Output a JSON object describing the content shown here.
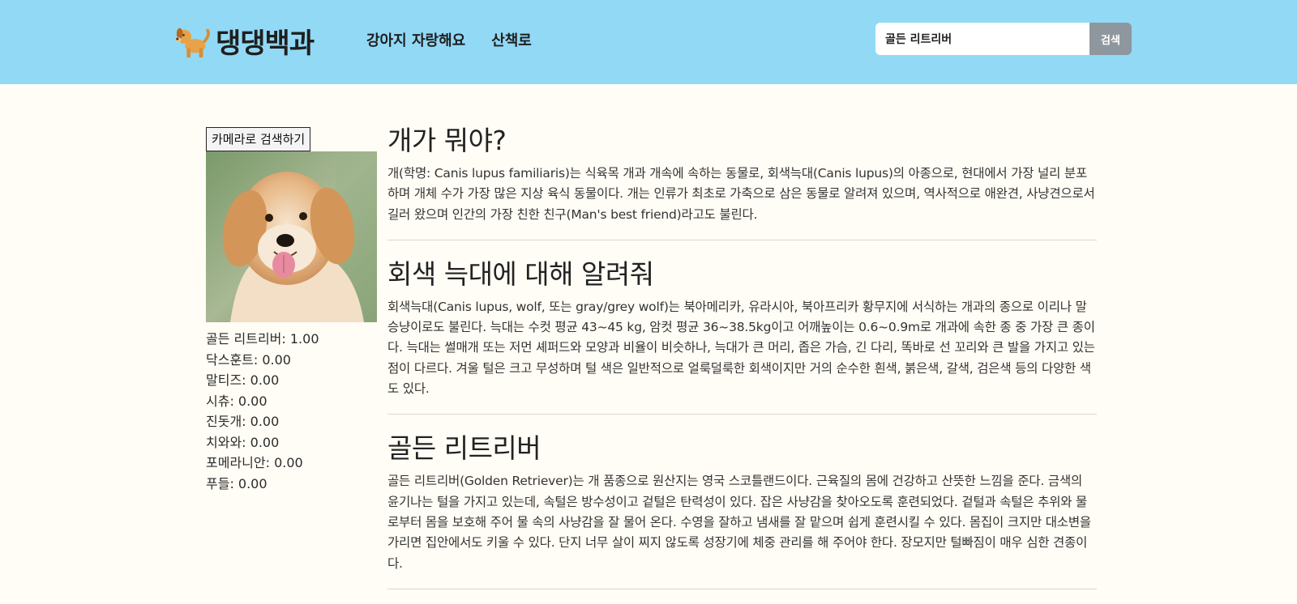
{
  "header": {
    "logo_text": "댕댕백과",
    "nav": [
      "강아지 자랑해요",
      "산책로"
    ],
    "search": {
      "value": "골든 리트리버",
      "button_label": "검색"
    }
  },
  "sidebar": {
    "camera_button_label": "카메라로 검색하기",
    "predictions": [
      {
        "label": "골든 리트리버: 1.00",
        "score": 1.0
      },
      {
        "label": "닥스훈트: 0.00",
        "score": 0.0
      },
      {
        "label": "말티즈: 0.00",
        "score": 0.0
      },
      {
        "label": "시츄: 0.00",
        "score": 0.0
      },
      {
        "label": "진돗개: 0.00",
        "score": 0.0
      },
      {
        "label": "치와와: 0.00",
        "score": 0.0
      },
      {
        "label": "포메라니안: 0.00",
        "score": 0.0
      },
      {
        "label": "푸들: 0.00",
        "score": 0.0
      }
    ]
  },
  "sections": [
    {
      "title": "개가 뭐야?",
      "body": "개(학명: Canis lupus familiaris)는 식육목 개과 개속에 속하는 동물로, 회색늑대(Canis lupus)의 아종으로, 현대에서 가장 널리 분포하며 개체 수가 가장 많은 지상 육식 동물이다. 개는 인류가 최초로 가축으로 삼은 동물로 알려져 있으며, 역사적으로 애완견, 사냥견으로서 길러 왔으며 인간의 가장 친한 친구(Man's best friend)라고도 불린다."
    },
    {
      "title": "회색 늑대에 대해 알려줘",
      "body": "회색늑대(Canis lupus, wolf, 또는 gray/grey wolf)는 북아메리카, 유라시아, 북아프리카 황무지에 서식하는 개과의 종으로 이리나 말승냥이로도 불린다. 늑대는 수컷 평균 43~45 kg, 암컷 평균 36~38.5kg이고 어깨높이는 0.6~0.9m로 개과에 속한 종 중 가장 큰 종이다. 늑대는 썰매개 또는 저먼 셰퍼드와 모양과 비율이 비슷하나, 늑대가 큰 머리, 좁은 가슴, 긴 다리, 똑바로 선 꼬리와 큰 발을 가지고 있는 점이 다르다. 겨울 털은 크고 무성하며 털 색은 일반적으로 얼룩덜룩한 회색이지만 거의 순수한 흰색, 붉은색, 갈색, 검은색 등의 다양한 색도 있다."
    },
    {
      "title": "골든 리트리버",
      "body": "골든 리트리버(Golden Retriever)는 개 품종으로 원산지는 영국 스코틀랜드이다. 근육질의 몸에 건강하고 산뜻한 느낌을 준다. 금색의 윤기나는 털을 가지고 있는데, 속털은 방수성이고 겉털은 탄력성이 있다. 잡은 사냥감을 찾아오도록 훈련되었다. 겉털과 속털은 추위와 물로부터 몸을 보호해 주어 물 속의 사냥감을 잘 물어 온다. 수영을 잘하고 냄새를 잘 맡으며 쉽게 훈련시킬 수 있다. 몸집이 크지만 대소변을 가리면 집안에서도 키울 수 있다. 단지 너무 살이 찌지 않도록 성장기에 체중 관리를 해 주어야 한다. 장모지만 털빠짐이 매우 심한 견종이다."
    }
  ],
  "colors": {
    "header_bg": "#92d9f6",
    "page_bg": "#fffdf5",
    "search_button": "#8f979e"
  }
}
